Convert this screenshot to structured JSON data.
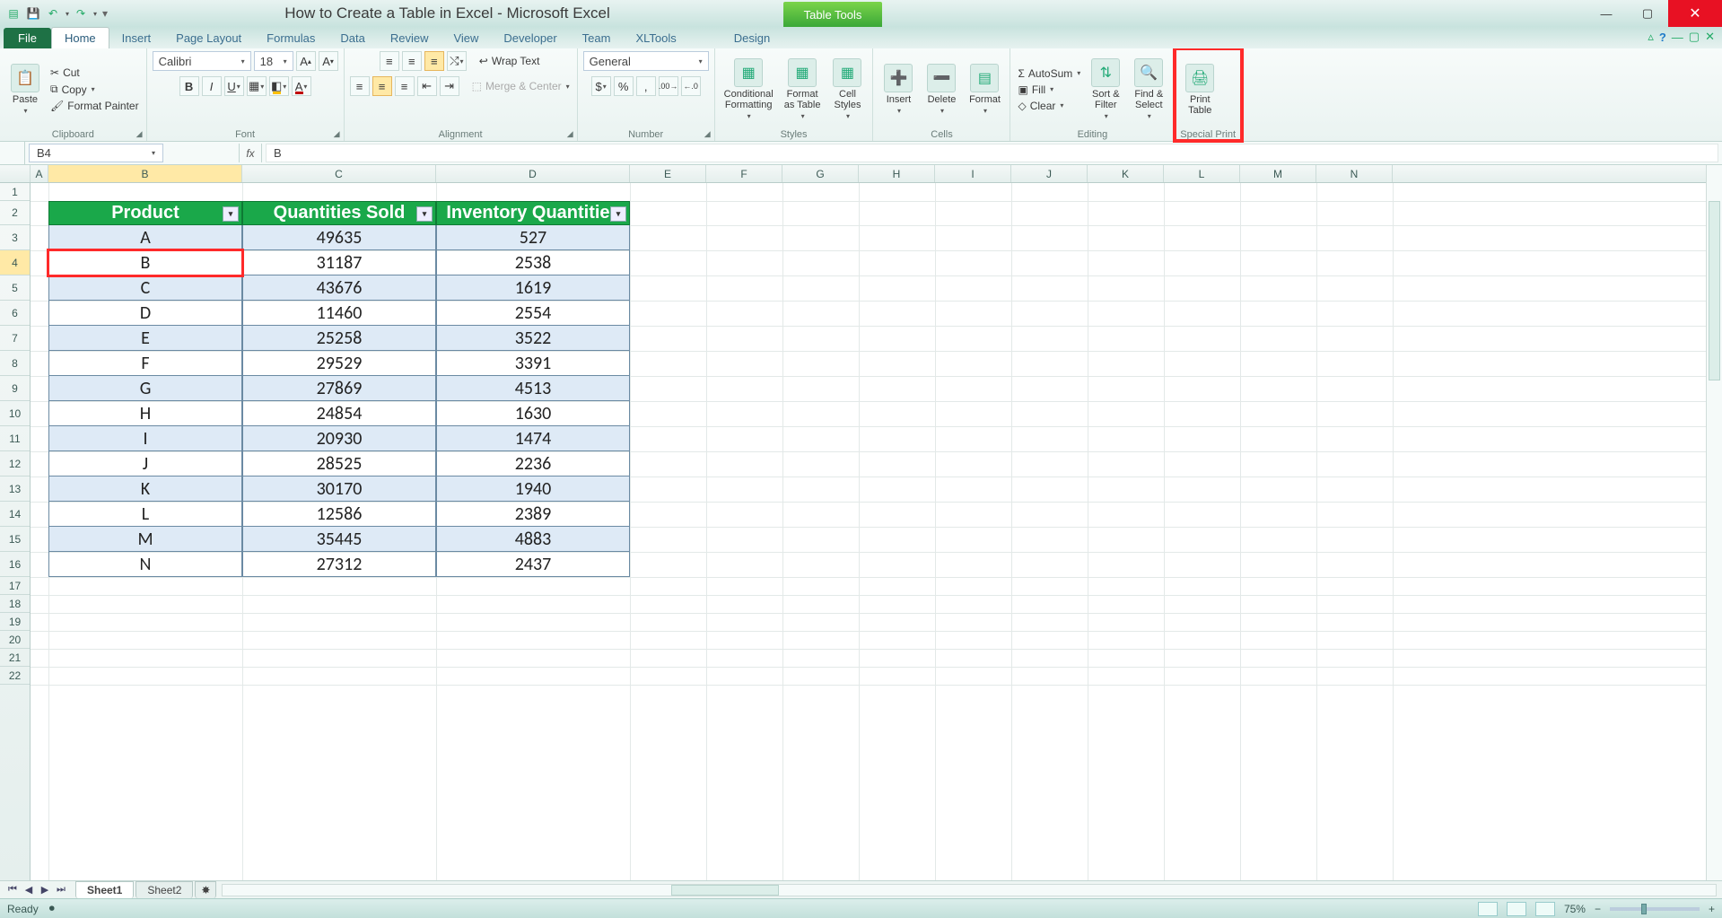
{
  "title": "How to Create a Table in Excel - Microsoft Excel",
  "tabletools_label": "Table Tools",
  "tabs": {
    "file": "File",
    "list": [
      "Home",
      "Insert",
      "Page Layout",
      "Formulas",
      "Data",
      "Review",
      "View",
      "Developer",
      "Team",
      "XLTools"
    ],
    "active": "Home",
    "design": "Design"
  },
  "ribbon": {
    "clipboard": {
      "label": "Clipboard",
      "paste": "Paste",
      "cut": "Cut",
      "copy": "Copy",
      "fp": "Format Painter"
    },
    "font": {
      "label": "Font",
      "name": "Calibri",
      "size": "18"
    },
    "alignment": {
      "label": "Alignment",
      "wrap": "Wrap Text",
      "merge": "Merge & Center"
    },
    "number": {
      "label": "Number",
      "format": "General"
    },
    "styles": {
      "label": "Styles",
      "cond": "Conditional\nFormatting",
      "fat": "Format\nas Table",
      "cs": "Cell\nStyles"
    },
    "cells": {
      "label": "Cells",
      "ins": "Insert",
      "del": "Delete",
      "fmt": "Format"
    },
    "editing": {
      "label": "Editing",
      "autosum": "AutoSum",
      "fill": "Fill",
      "clear": "Clear",
      "sort": "Sort &\nFilter",
      "find": "Find &\nSelect"
    },
    "special": {
      "label": "Special Print",
      "print": "Print\nTable"
    }
  },
  "namebox": "B4",
  "formula": "B",
  "columns": [
    "A",
    "B",
    "C",
    "D",
    "E",
    "F",
    "G",
    "H",
    "I",
    "J",
    "K",
    "L",
    "M",
    "N"
  ],
  "row_count": 22,
  "selected_row": 4,
  "selected_col": "B",
  "table": {
    "headers": [
      "Product",
      "Quantities Sold",
      "Inventory Quantities"
    ],
    "rows": [
      [
        "A",
        "49635",
        "527"
      ],
      [
        "B",
        "31187",
        "2538"
      ],
      [
        "C",
        "43676",
        "1619"
      ],
      [
        "D",
        "11460",
        "2554"
      ],
      [
        "E",
        "25258",
        "3522"
      ],
      [
        "F",
        "29529",
        "3391"
      ],
      [
        "G",
        "27869",
        "4513"
      ],
      [
        "H",
        "24854",
        "1630"
      ],
      [
        "I",
        "20930",
        "1474"
      ],
      [
        "J",
        "28525",
        "2236"
      ],
      [
        "K",
        "30170",
        "1940"
      ],
      [
        "L",
        "12586",
        "2389"
      ],
      [
        "M",
        "35445",
        "4883"
      ],
      [
        "N",
        "27312",
        "2437"
      ]
    ]
  },
  "sheets": {
    "active": "Sheet1",
    "other": "Sheet2"
  },
  "status": {
    "ready": "Ready",
    "zoom": "75%"
  }
}
